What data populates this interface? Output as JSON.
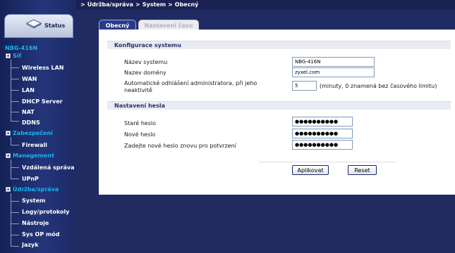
{
  "breadcrumb": {
    "items": [
      "Údržba/správa",
      "System",
      "Obecný"
    ]
  },
  "status_tab": {
    "label": "Status",
    "icon": "router-icon"
  },
  "sidebar": {
    "device_name": "NBG-416N",
    "groups": [
      {
        "label": "Síť",
        "items": [
          "Wireless LAN",
          "WAN",
          "LAN",
          "DHCP Server",
          "NAT",
          "DDNS"
        ]
      },
      {
        "label": "Zabezpečení",
        "items": [
          "Firewall"
        ]
      },
      {
        "label": "Management",
        "items": [
          "Vzdálená správa",
          "UPnP"
        ]
      },
      {
        "label": "Údržba/správa",
        "items": [
          "System",
          "Logy/protokoly",
          "Nástroje",
          "Sys OP mód",
          "Jazyk"
        ]
      }
    ]
  },
  "tabs": [
    {
      "label": "Obecný",
      "active": true
    },
    {
      "label": "Nastavení času",
      "active": false
    }
  ],
  "system_config": {
    "header": "Konfigurace systemu",
    "system_name_label": "Název systemu",
    "system_name_value": "NBG-416N",
    "domain_name_label": "Nazev domény",
    "domain_name_value": "zyxel.com",
    "logout_label_line1": "Automatické odhlášení administratora, při jeho",
    "logout_label_line2": "neaktivitě",
    "logout_value": "5",
    "logout_hint": "(minuty, 0 znamená bez časového limitu)"
  },
  "password_settings": {
    "header": "Nastavení hesla",
    "old_password_label": "Staré heslo",
    "old_password_value": "●●●●●●●●●●",
    "new_password_label": "Nové heslo",
    "new_password_value": "●●●●●●●●●●",
    "confirm_password_label": "Zadejte nové heslo znovu pro potvrzení",
    "confirm_password_value": "●●●●●●●●●●"
  },
  "buttons": {
    "apply": "Aplikovat",
    "reset": "Reset"
  },
  "colors": {
    "sidebar_bg": "#24357a",
    "group_text": "#19b4ee",
    "item_text": "#ffffff",
    "active_tab": "#2a3a8c",
    "section_header_bg": "#e8ebf1"
  }
}
